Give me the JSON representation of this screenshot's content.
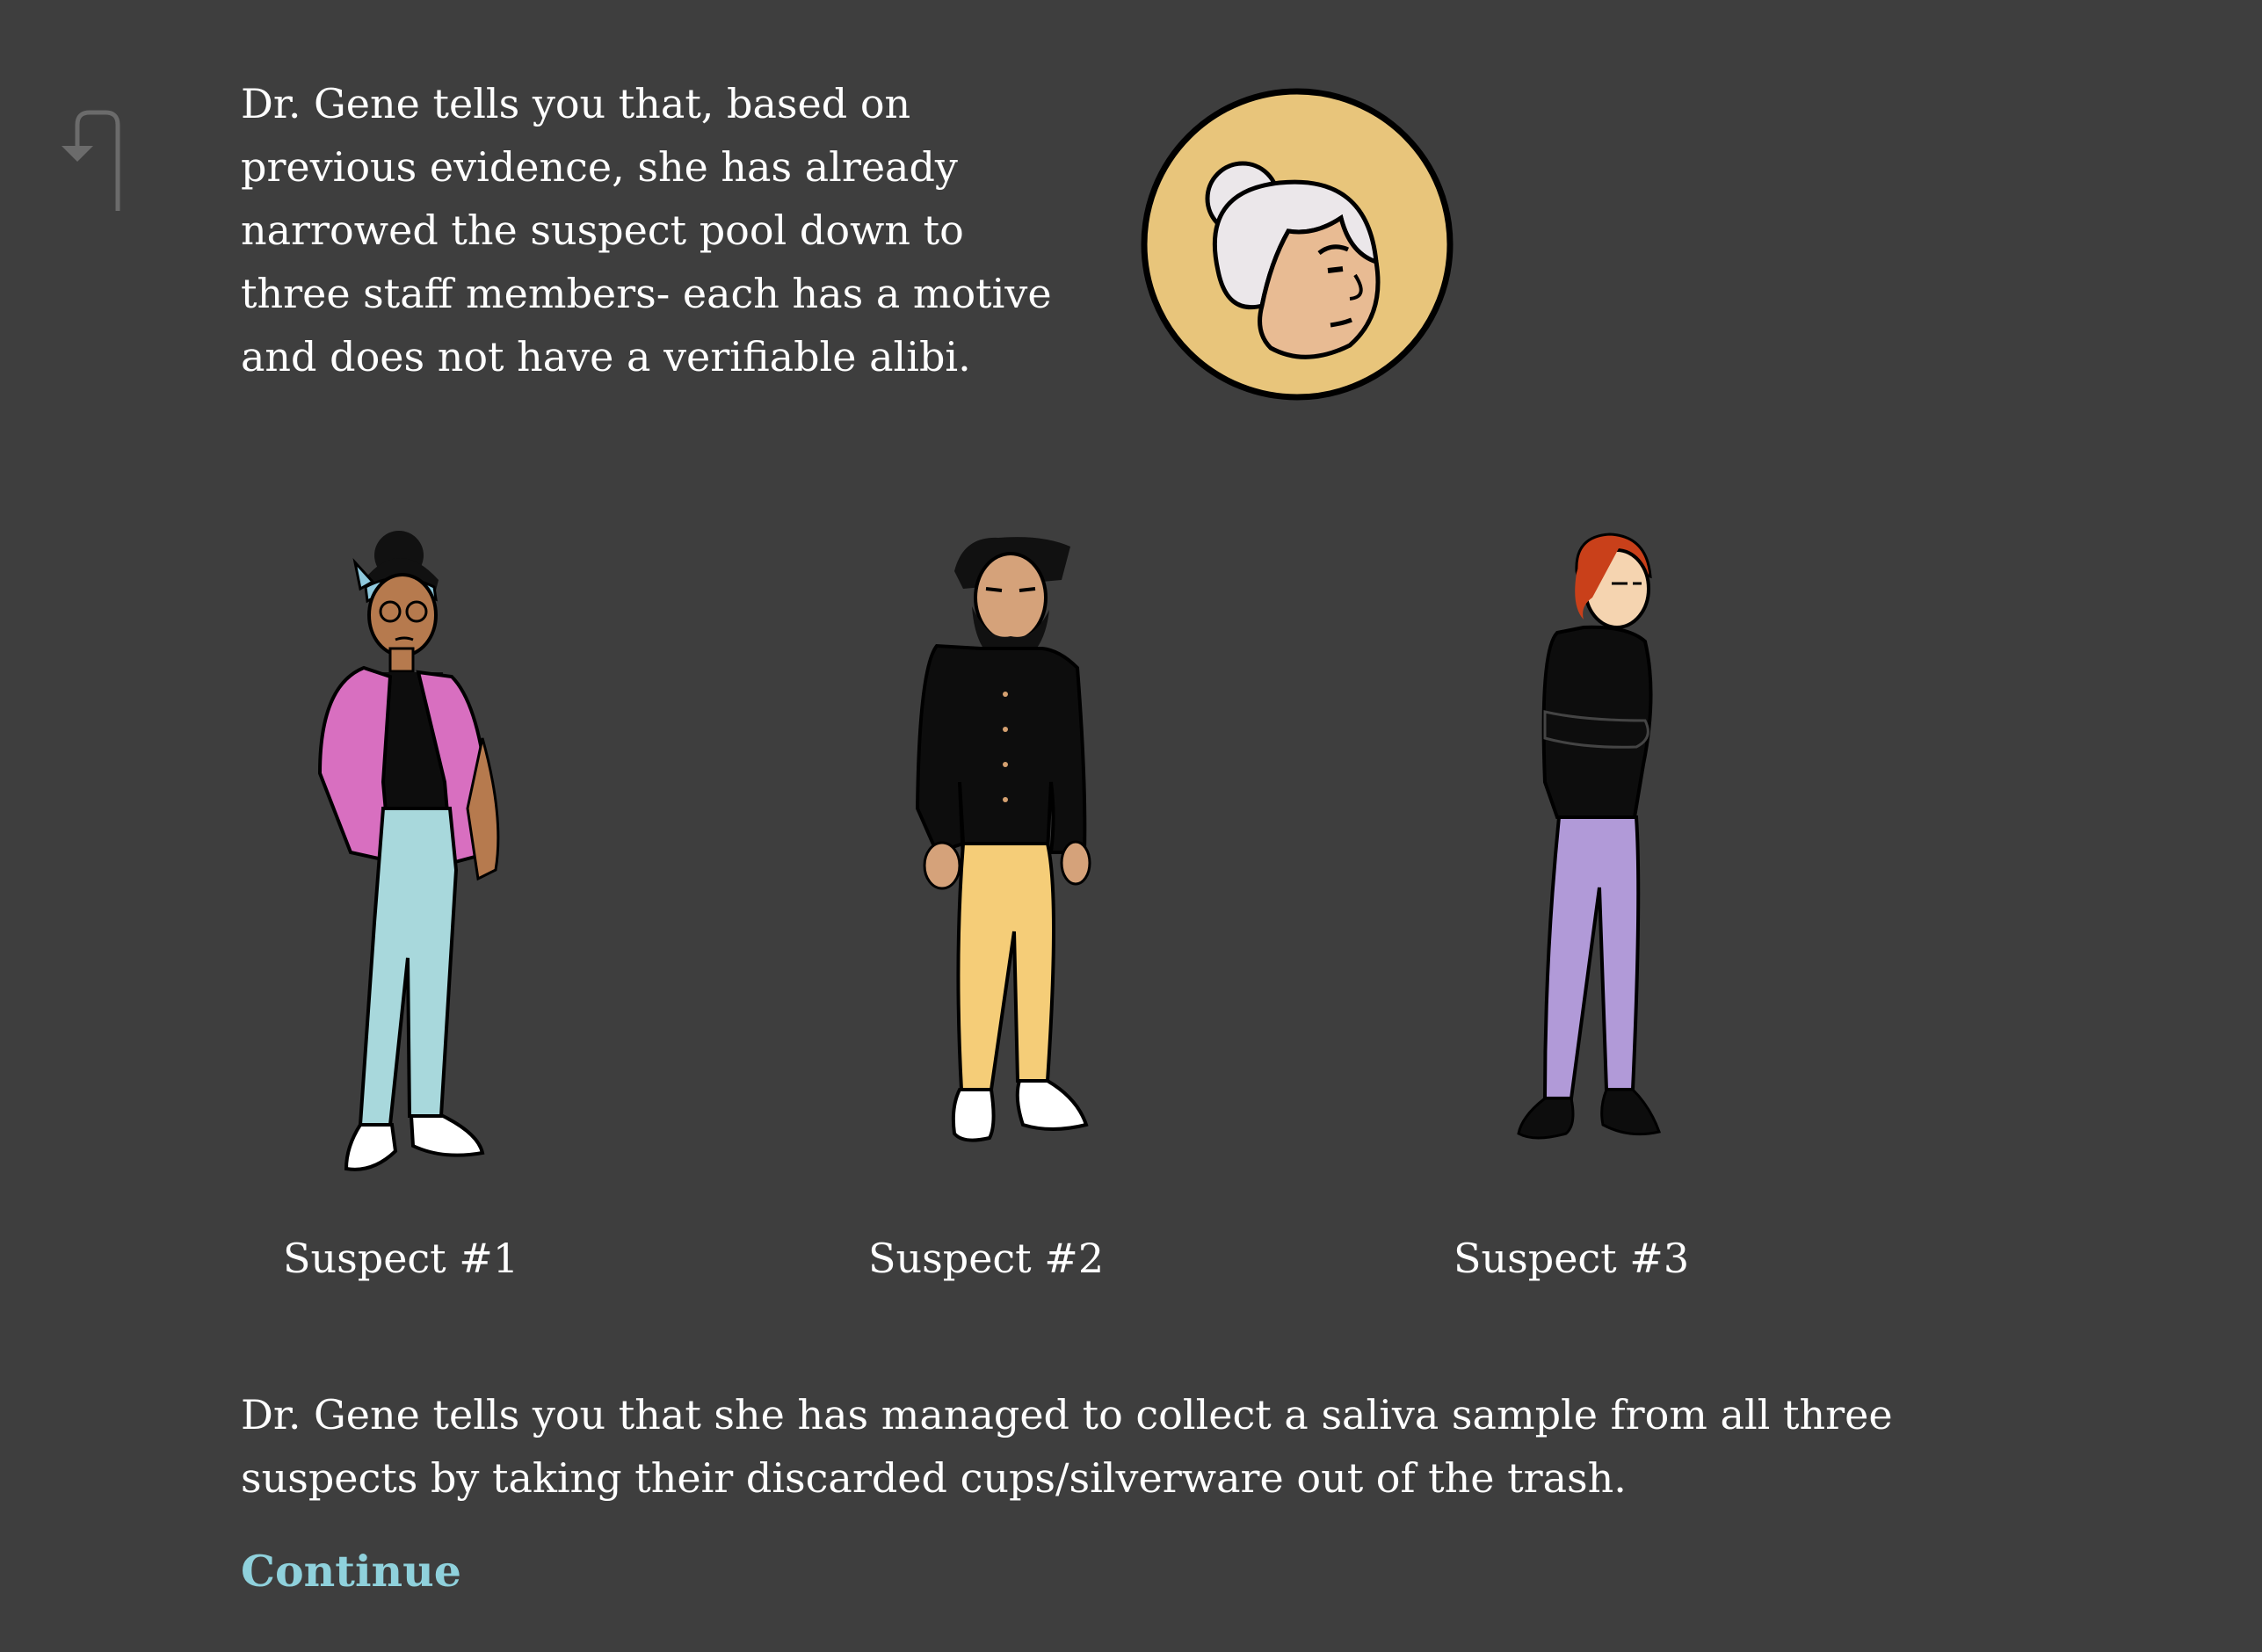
{
  "back_link": {
    "icon": "return-arrow-icon"
  },
  "intro": {
    "text": "Dr. Gene tells you that, based on previous evidence, she has already narrowed the suspect pool down to three staff members- each has a motive and does not have a verifiable alibi."
  },
  "avatar": {
    "icon": "dr-gene-avatar",
    "bg_color": "#e8c57b"
  },
  "suspects": [
    {
      "label": "Suspect #1",
      "jacket_color": "#d86fc0",
      "pants_color": "#a8d8dc"
    },
    {
      "label": "Suspect #2",
      "jacket_color": "#0d0d0d",
      "pants_color": "#f5cd78"
    },
    {
      "label": "Suspect #3",
      "jacket_color": "#0d0d0d",
      "pants_color": "#b19ad8"
    }
  ],
  "outro": {
    "text": "Dr. Gene tells you that she has managed to collect a saliva sample from all three suspects by taking their discarded cups/silverware out of the trash."
  },
  "continue_label": "Continue",
  "colors": {
    "background": "#3e3e3e",
    "link": "#8fd1dc",
    "text": "#ffffff"
  }
}
